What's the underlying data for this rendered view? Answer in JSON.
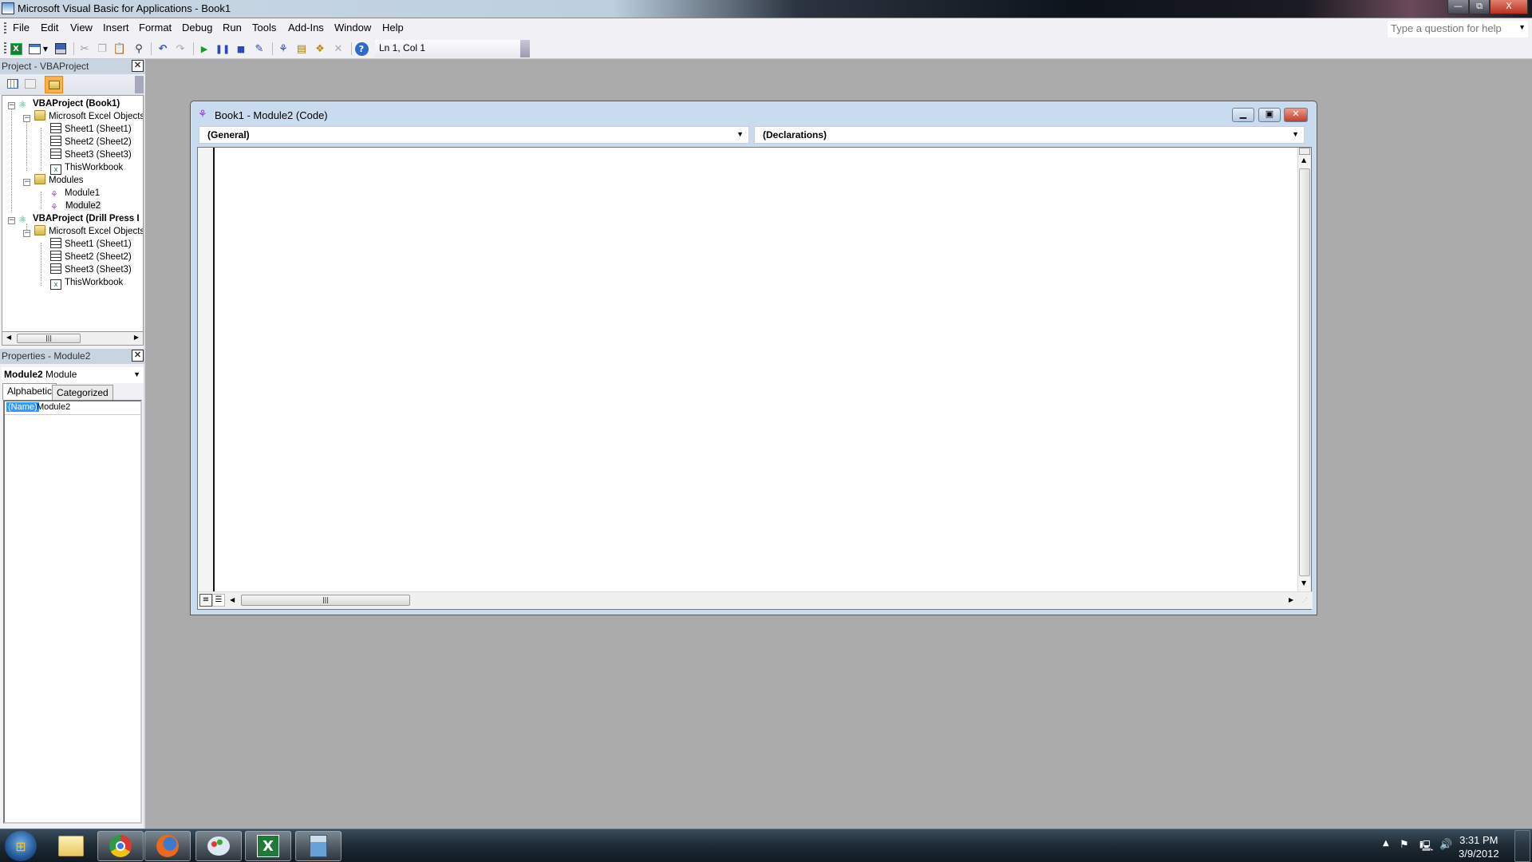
{
  "window": {
    "title": "Microsoft Visual Basic for Applications - Book1",
    "controls": {
      "minimize": "—",
      "restore": "⧉",
      "close": "X"
    }
  },
  "menubar": {
    "items": [
      "File",
      "Edit",
      "View",
      "Insert",
      "Format",
      "Debug",
      "Run",
      "Tools",
      "Add-Ins",
      "Window",
      "Help"
    ],
    "help_placeholder": "Type a question for help"
  },
  "toolbar": {
    "buttons": [
      {
        "name": "view-excel",
        "icon": "excel-icon"
      },
      {
        "name": "insert-userform",
        "icon": "userform-icon"
      },
      {
        "name": "save",
        "icon": "save-icon"
      },
      {
        "name": "cut",
        "icon": "scissors-icon"
      },
      {
        "name": "copy",
        "icon": "copy-icon"
      },
      {
        "name": "paste",
        "icon": "paste-icon"
      },
      {
        "name": "find",
        "icon": "binoculars-icon"
      },
      {
        "name": "undo",
        "icon": "undo-icon"
      },
      {
        "name": "redo",
        "icon": "redo-icon"
      },
      {
        "name": "run",
        "icon": "play-icon"
      },
      {
        "name": "break",
        "icon": "pause-icon"
      },
      {
        "name": "reset",
        "icon": "stop-icon"
      },
      {
        "name": "design-mode",
        "icon": "design-icon"
      },
      {
        "name": "project-explorer",
        "icon": "project-explorer-icon"
      },
      {
        "name": "properties-window",
        "icon": "properties-icon"
      },
      {
        "name": "object-browser",
        "icon": "object-browser-icon"
      },
      {
        "name": "toolbox",
        "icon": "toolbox-icon"
      },
      {
        "name": "help",
        "icon": "help-icon"
      }
    ],
    "position": "Ln 1, Col 1"
  },
  "project_panel": {
    "title": "Project - VBAProject",
    "tree": [
      {
        "label": "VBAProject (Book1)",
        "level": 0,
        "type": "project",
        "bold": true,
        "expanded": true
      },
      {
        "label": "Microsoft Excel Objects",
        "level": 1,
        "type": "folder",
        "expanded": true
      },
      {
        "label": "Sheet1 (Sheet1)",
        "level": 2,
        "type": "sheet"
      },
      {
        "label": "Sheet2 (Sheet2)",
        "level": 2,
        "type": "sheet"
      },
      {
        "label": "Sheet3 (Sheet3)",
        "level": 2,
        "type": "sheet"
      },
      {
        "label": "ThisWorkbook",
        "level": 2,
        "type": "workbook"
      },
      {
        "label": "Modules",
        "level": 1,
        "type": "folder",
        "expanded": true
      },
      {
        "label": "Module1",
        "level": 2,
        "type": "module"
      },
      {
        "label": "Module2",
        "level": 2,
        "type": "module",
        "selected": true
      },
      {
        "label": "VBAProject (Drill Press I",
        "level": 0,
        "type": "project",
        "bold": true,
        "expanded": true
      },
      {
        "label": "Microsoft Excel Objects",
        "level": 1,
        "type": "folder",
        "expanded": true
      },
      {
        "label": "Sheet1 (Sheet1)",
        "level": 2,
        "type": "sheet"
      },
      {
        "label": "Sheet2 (Sheet2)",
        "level": 2,
        "type": "sheet"
      },
      {
        "label": "Sheet3 (Sheet3)",
        "level": 2,
        "type": "sheet"
      },
      {
        "label": "ThisWorkbook",
        "level": 2,
        "type": "workbook"
      }
    ]
  },
  "properties_panel": {
    "title": "Properties - Module2",
    "object_name": "Module2",
    "object_type": "Module",
    "tabs": [
      "Alphabetic",
      "Categorized"
    ],
    "active_tab": "Alphabetic",
    "rows": [
      {
        "name": "(Name)",
        "value": "Module2"
      }
    ]
  },
  "code_window": {
    "title": "Book1 - Module2 (Code)",
    "object_combo": "(General)",
    "procedure_combo": "(Declarations)",
    "code": ""
  },
  "taskbar": {
    "apps": [
      {
        "name": "windows-explorer",
        "icon": "folder-icon"
      },
      {
        "name": "chrome",
        "icon": "chrome-icon"
      },
      {
        "name": "firefox",
        "icon": "firefox-icon"
      },
      {
        "name": "paint",
        "icon": "paint-icon"
      },
      {
        "name": "excel",
        "icon": "excel-icon"
      },
      {
        "name": "calculator",
        "icon": "calculator-icon"
      }
    ],
    "time": "3:31 PM",
    "date": "3/9/2012"
  }
}
